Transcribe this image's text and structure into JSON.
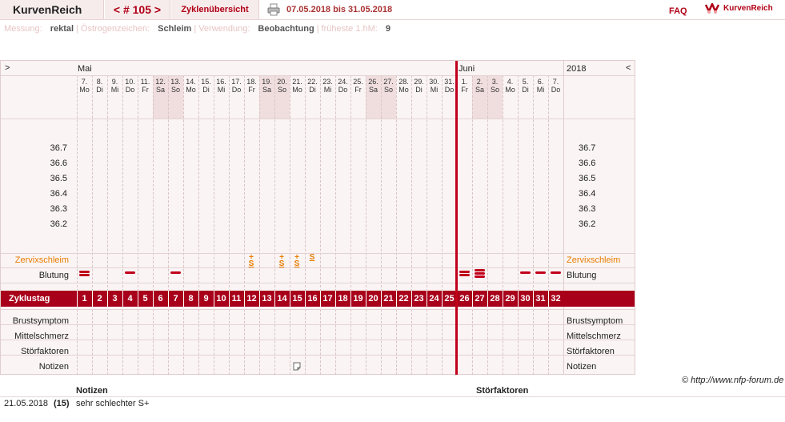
{
  "header": {
    "title": "KurvenReich",
    "cycle_nav": "< # 105 >",
    "overview": "Zyklenübersicht",
    "date_range": "07.05.2018 bis 31.05.2018",
    "faq": "FAQ",
    "brand": "KurvenReich"
  },
  "meta": [
    {
      "label": "Messung:",
      "value": "rektal"
    },
    {
      "label": "Östrogenzeichen:",
      "value": "Schleim"
    },
    {
      "label": "Verwendung:",
      "value": "Beobachtung"
    },
    {
      "label": "früheste 1.hM:",
      "value": "9"
    }
  ],
  "chart": {
    "nav_left": ">",
    "nav_right": "<",
    "month1": "Mai",
    "month2": "Juni",
    "year": "2018",
    "days": [
      [
        "7.",
        "Mo"
      ],
      [
        "8.",
        "Di"
      ],
      [
        "9.",
        "Mi"
      ],
      [
        "10.",
        "Do"
      ],
      [
        "11.",
        "Fr"
      ],
      [
        "12.",
        "Sa"
      ],
      [
        "13.",
        "So"
      ],
      [
        "14.",
        "Mo"
      ],
      [
        "15.",
        "Di"
      ],
      [
        "16.",
        "Mi"
      ],
      [
        "17.",
        "Do"
      ],
      [
        "18.",
        "Fr"
      ],
      [
        "19.",
        "Sa"
      ],
      [
        "20.",
        "So"
      ],
      [
        "21.",
        "Mo"
      ],
      [
        "22.",
        "Di"
      ],
      [
        "23.",
        "Mi"
      ],
      [
        "24.",
        "Do"
      ],
      [
        "25.",
        "Fr"
      ],
      [
        "26.",
        "Sa"
      ],
      [
        "27.",
        "So"
      ],
      [
        "28.",
        "Mo"
      ],
      [
        "29.",
        "Di"
      ],
      [
        "30.",
        "Mi"
      ],
      [
        "31.",
        "Do"
      ],
      [
        "1.",
        "Fr"
      ],
      [
        "2.",
        "Sa"
      ],
      [
        "3.",
        "So"
      ],
      [
        "4.",
        "Mo"
      ],
      [
        "5.",
        "Di"
      ],
      [
        "6.",
        "Mi"
      ],
      [
        "7.",
        "Do"
      ]
    ],
    "weekends": [
      5,
      6,
      12,
      13,
      19,
      20,
      26,
      27
    ],
    "temps": [
      "36.7",
      "36.6",
      "36.5",
      "36.4",
      "36.3",
      "36.2"
    ],
    "mucus_label": "Zervixschleim",
    "bleeding_label": "Blutung",
    "cycle_label": "Zyklustag",
    "cycle_days": [
      "1",
      "2",
      "3",
      "4",
      "5",
      "6",
      "7",
      "8",
      "9",
      "10",
      "11",
      "12",
      "13",
      "14",
      "15",
      "16",
      "17",
      "18",
      "19",
      "20",
      "21",
      "22",
      "23",
      "24",
      "25",
      "26",
      "27",
      "28",
      "29",
      "30",
      "31",
      "32"
    ],
    "mucus": [
      {
        "day": 11,
        "sym": "S",
        "plus": "+"
      },
      {
        "day": 13,
        "sym": "S",
        "plus": "+"
      },
      {
        "day": 14,
        "sym": "S",
        "plus": "+"
      },
      {
        "day": 15,
        "sym": "S",
        "plus": ""
      }
    ],
    "bleeding": [
      {
        "day": 0,
        "strength": 2
      },
      {
        "day": 3,
        "strength": 1
      },
      {
        "day": 6,
        "strength": 1
      },
      {
        "day": 25,
        "strength": 2
      },
      {
        "day": 26,
        "strength": 3
      },
      {
        "day": 29,
        "strength": 1
      },
      {
        "day": 30,
        "strength": 1
      },
      {
        "day": 31,
        "strength": 1
      }
    ],
    "extra_rows": [
      "Brustsymptom",
      "Mittelschmerz",
      "Störfaktoren",
      "Notizen"
    ],
    "note_day": 14
  },
  "copyright": "© http://www.nfp-forum.de",
  "notes": {
    "col1": "Notizen",
    "col2": "Störfaktoren",
    "entries": [
      {
        "date": "21.05.2018",
        "cycle_day": "(15)",
        "text": "sehr schlechter S+"
      }
    ]
  },
  "colors": {
    "accent": "#b00016",
    "mucus": "#e87d00",
    "weekend": "#f0dede"
  }
}
